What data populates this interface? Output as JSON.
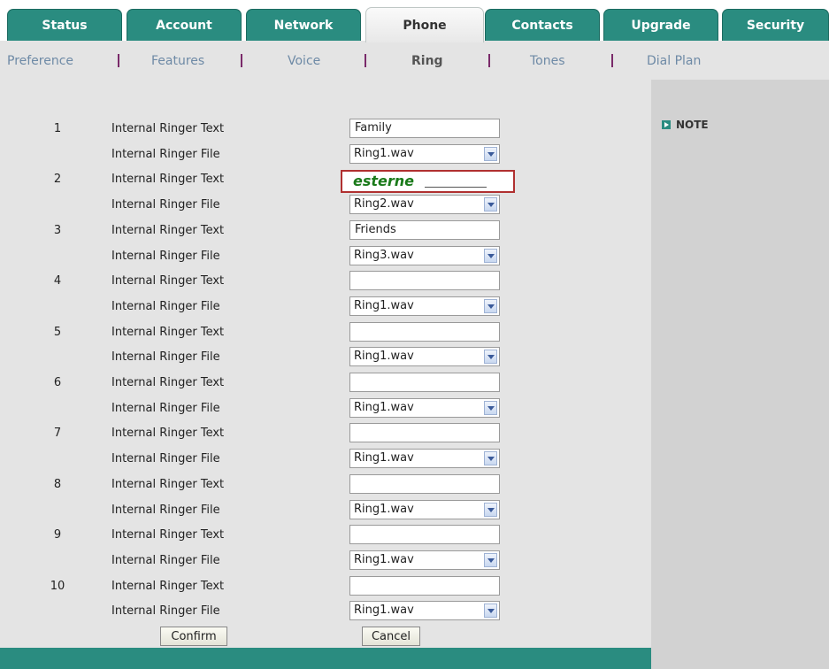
{
  "tabs": [
    {
      "label": "Status"
    },
    {
      "label": "Account"
    },
    {
      "label": "Network"
    },
    {
      "label": "Phone"
    },
    {
      "label": "Contacts"
    },
    {
      "label": "Upgrade"
    },
    {
      "label": "Security"
    }
  ],
  "subnav": [
    {
      "label": "Preference"
    },
    {
      "label": "Features"
    },
    {
      "label": "Voice"
    },
    {
      "label": "Ring"
    },
    {
      "label": "Tones"
    },
    {
      "label": "Dial Plan"
    }
  ],
  "note_label": "NOTE",
  "text_label": "Internal Ringer Text",
  "file_label": "Internal Ringer File",
  "ringers": [
    {
      "num": "1",
      "text": "Family",
      "file": "Ring1.wav"
    },
    {
      "num": "2",
      "text": "esterne",
      "file": "Ring2.wav"
    },
    {
      "num": "3",
      "text": "Friends",
      "file": "Ring3.wav"
    },
    {
      "num": "4",
      "text": "",
      "file": "Ring1.wav"
    },
    {
      "num": "5",
      "text": "",
      "file": "Ring1.wav"
    },
    {
      "num": "6",
      "text": "",
      "file": "Ring1.wav"
    },
    {
      "num": "7",
      "text": "",
      "file": "Ring1.wav"
    },
    {
      "num": "8",
      "text": "",
      "file": "Ring1.wav"
    },
    {
      "num": "9",
      "text": "",
      "file": "Ring1.wav"
    },
    {
      "num": "10",
      "text": "",
      "file": "Ring1.wav"
    }
  ],
  "buttons": {
    "confirm": "Confirm",
    "cancel": "Cancel"
  },
  "colors": {
    "accent": "#2a8c80",
    "highlight_border": "#b03030",
    "entry_text": "#1a7a1a"
  }
}
